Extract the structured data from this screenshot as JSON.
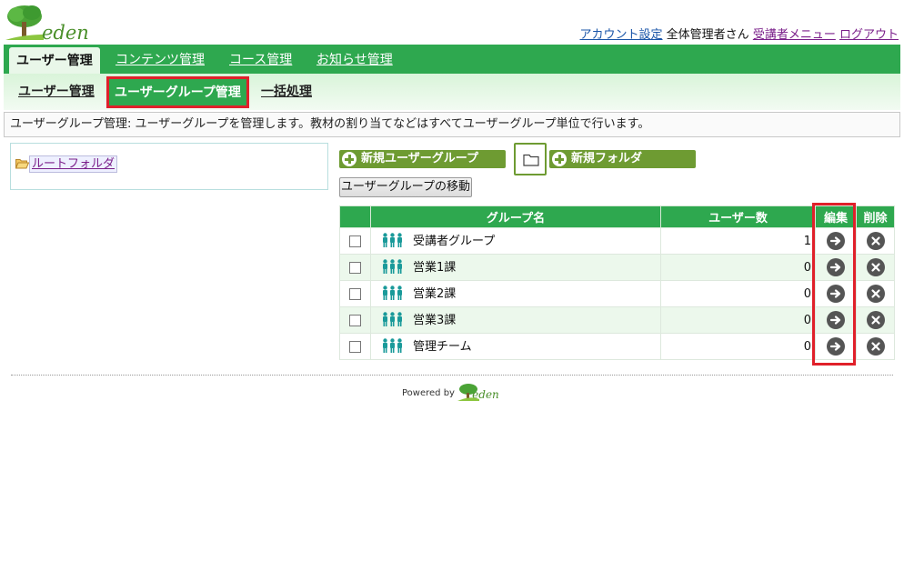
{
  "brand": {
    "logo_text": "eden"
  },
  "header": {
    "account_settings": "アカウント設定",
    "user_name": "全体管理者さん",
    "learner_menu": "受講者メニュー",
    "logout": "ログアウト"
  },
  "main_nav": [
    {
      "label": "ユーザー管理",
      "active": true
    },
    {
      "label": "コンテンツ管理",
      "active": false
    },
    {
      "label": "コース管理",
      "active": false
    },
    {
      "label": "お知らせ管理",
      "active": false
    }
  ],
  "sub_nav": [
    {
      "label": "ユーザー管理",
      "active": false
    },
    {
      "label": "ユーザーグループ管理",
      "active": true
    },
    {
      "label": "一括処理",
      "active": false
    }
  ],
  "description": "ユーザーグループ管理: ユーザーグループを管理します。教材の割り当てなどはすべてユーザーグループ単位で行います。",
  "tree": {
    "root_label": "ルートフォルダ"
  },
  "toolbar": {
    "new_group": "新規ユーザーグループ",
    "new_folder": "新規フォルダ",
    "move_group": "ユーザーグループの移動"
  },
  "table": {
    "headers": {
      "name": "グループ名",
      "count": "ユーザー数",
      "edit": "編集",
      "delete": "削除"
    },
    "rows": [
      {
        "name": "受講者グループ",
        "count": "1"
      },
      {
        "name": "営業1課",
        "count": "0"
      },
      {
        "name": "営業2課",
        "count": "0"
      },
      {
        "name": "営業3課",
        "count": "0"
      },
      {
        "name": "管理チーム",
        "count": "0"
      }
    ]
  },
  "footer": {
    "powered_by": "Powered by",
    "logo_text": "eden"
  },
  "colors": {
    "primary_green": "#2ea84f",
    "button_green": "#6e9b32",
    "highlight_red": "#e0202a",
    "people_icon": "#1a9a9a",
    "action_circle": "#555555"
  },
  "icons": {
    "folder": "folder-open-icon",
    "new": "plus-circle-icon",
    "people": "people-group-icon",
    "edit": "arrow-right-circle-icon",
    "delete": "close-circle-icon"
  }
}
